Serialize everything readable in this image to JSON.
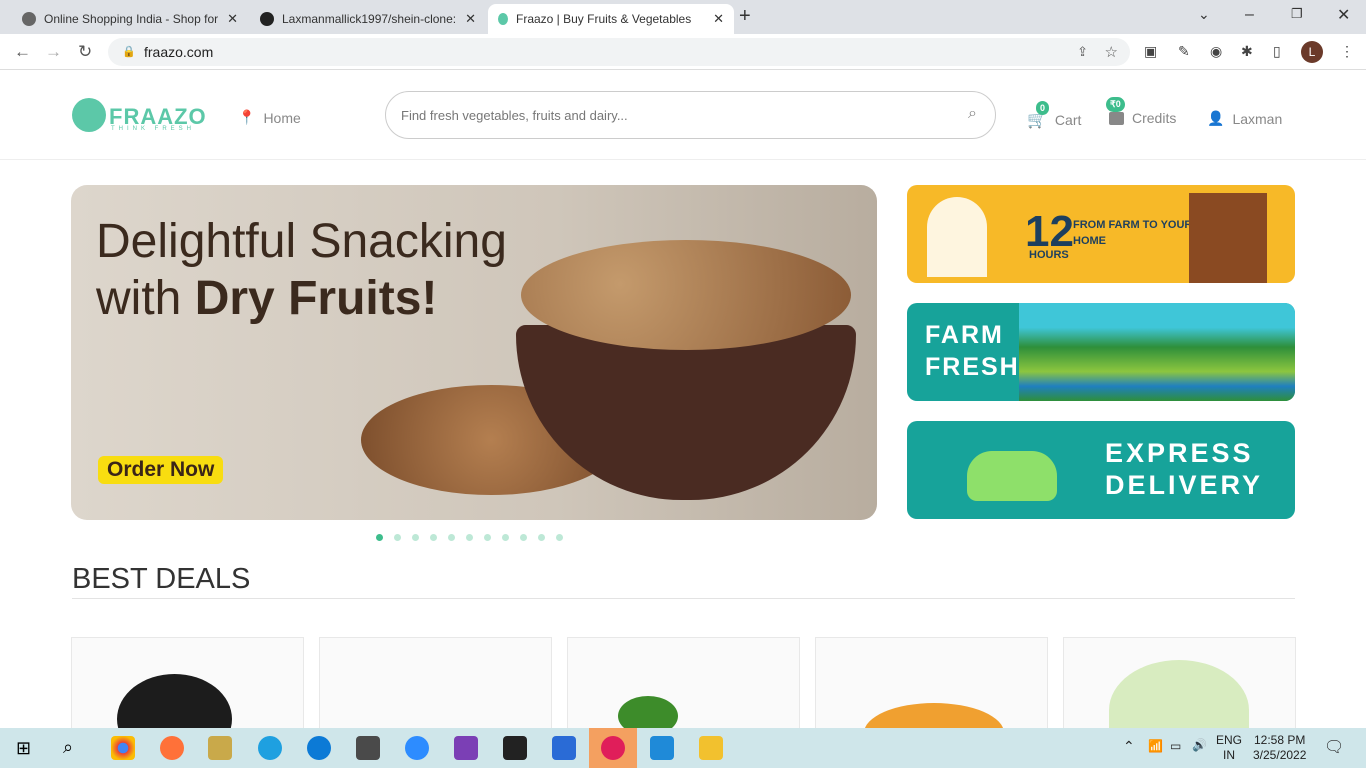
{
  "browser": {
    "tabs": [
      {
        "title": "Online Shopping India - Shop for"
      },
      {
        "title": "Laxmanmallick1997/shein-clone:"
      },
      {
        "title": "Fraazo | Buy Fruits & Vegetables"
      }
    ],
    "url": "fraazo.com",
    "profile_initial": "L"
  },
  "header": {
    "logo": "FRAAZO",
    "logo_tagline": "THINK FRESH",
    "location": "Home",
    "search_placeholder": "Find fresh vegetables, fruits and dairy...",
    "cart_label": "Cart",
    "cart_count": "0",
    "credits_label": "Credits",
    "credits_value": "₹0",
    "user": "Laxman",
    "brand_color": "#5cc8a8",
    "badge_color": "#3dbd8c"
  },
  "hero": {
    "line1": "Delightful Snacking",
    "line2_prefix": "with ",
    "line2_bold": "Dry Fruits!",
    "cta": "Order Now",
    "slide_count": 11,
    "active_slide": 1
  },
  "side_banners": [
    {
      "big": "12",
      "small": "HOURS",
      "text": "FROM FARM TO YOUR HOME",
      "color": "#f7b928"
    },
    {
      "text": "FARM FRESH",
      "color": "#17a39a"
    },
    {
      "text": "EXPRESS DELIVERY",
      "color": "#17a39a"
    }
  ],
  "section": {
    "title": "BEST DEALS"
  },
  "taskbar": {
    "lang1": "ENG",
    "lang2": "IN",
    "time": "12:58 PM",
    "date": "3/25/2022"
  }
}
